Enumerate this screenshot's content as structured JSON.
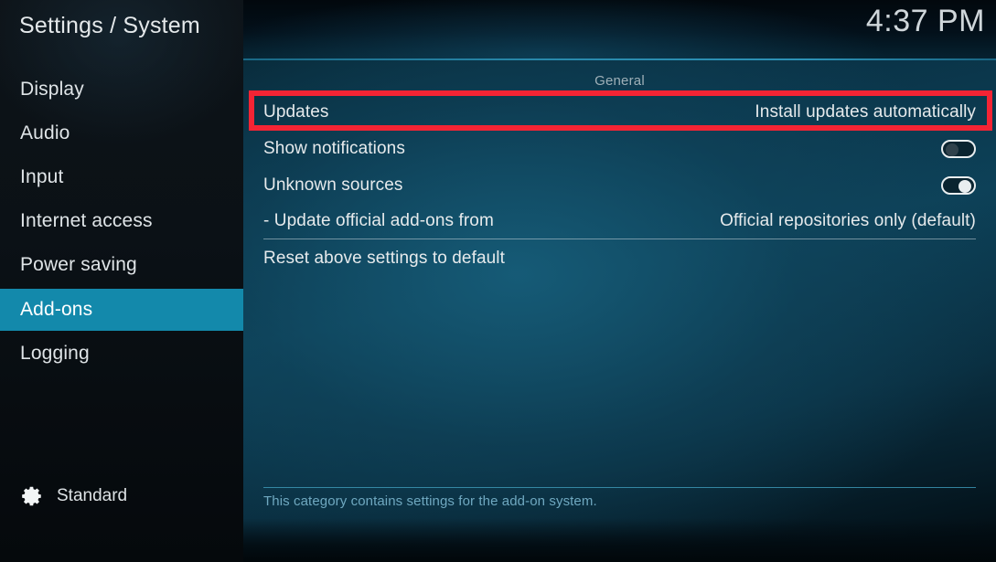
{
  "header": {
    "title": "Settings / System",
    "clock": "4:37 PM"
  },
  "sidebar": {
    "items": [
      {
        "label": "Display",
        "selected": false
      },
      {
        "label": "Audio",
        "selected": false
      },
      {
        "label": "Input",
        "selected": false
      },
      {
        "label": "Internet access",
        "selected": false
      },
      {
        "label": "Power saving",
        "selected": false
      },
      {
        "label": "Add-ons",
        "selected": true
      },
      {
        "label": "Logging",
        "selected": false
      }
    ],
    "profile": {
      "icon": "gear-icon",
      "label": "Standard"
    },
    "selected_color": "#1389ab"
  },
  "main": {
    "group_label": "General",
    "rows": [
      {
        "label": "Updates",
        "value": "Install updates automatically",
        "type": "value",
        "highlighted": true
      },
      {
        "label": "Show notifications",
        "value": "off",
        "type": "toggle",
        "highlighted": false
      },
      {
        "label": "Unknown sources",
        "value": "on",
        "type": "toggle",
        "highlighted": false
      },
      {
        "label": "- Update official add-ons from",
        "value": "Official repositories only (default)",
        "type": "value",
        "highlighted": false
      },
      {
        "label": "Reset above settings to default",
        "value": "",
        "type": "action",
        "highlighted": false
      }
    ],
    "footer_text": "This category contains settings for the add-on system."
  },
  "annotation": {
    "name": "red-highlight-box",
    "color": "#f42434",
    "target": "Updates"
  }
}
